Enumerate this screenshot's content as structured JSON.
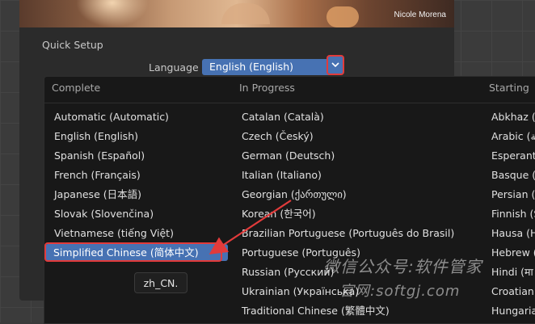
{
  "splash": {
    "credit": "Nicole Morena",
    "quick_setup": "Quick Setup",
    "language_label": "Language",
    "language_value": "English (English)"
  },
  "menu": {
    "columns": [
      {
        "header": "Complete",
        "items": [
          "Automatic (Automatic)",
          "English (English)",
          "Spanish (Español)",
          "French (Français)",
          "Japanese (日本語)",
          "Slovak (Slovenčina)",
          "Vietnamese (tiếng Việt)",
          "Simplified Chinese (简体中文)"
        ],
        "active_index": 7
      },
      {
        "header": "In Progress",
        "items": [
          "Catalan (Català)",
          "Czech (Český)",
          "German (Deutsch)",
          "Italian (Italiano)",
          "Georgian (ქართული)",
          "Korean (한국어)",
          "Brazilian Portuguese (Português do Brasil)",
          "Portuguese (Português)",
          "Russian (Русский)",
          "Ukrainian (Українська)",
          "Traditional Chinese (繁體中文)"
        ]
      },
      {
        "header": "Starting",
        "items": [
          "Abkhaz (A",
          "Arabic (ﺔ",
          "Esperanto",
          "Basque (E",
          "Persian (.",
          "Finnish (S",
          "Hausa (H",
          "Hebrew (",
          "Hindi (मा",
          "Croatian",
          "Hungaria"
        ]
      }
    ]
  },
  "tooltip": "zh_CN.",
  "watermark": {
    "line1": "微信公众号:软件管家",
    "line2": "官网:softgj.com"
  },
  "colors": {
    "accent": "#4772b3",
    "annotation": "#e23b3b",
    "menu_bg": "#181818"
  }
}
